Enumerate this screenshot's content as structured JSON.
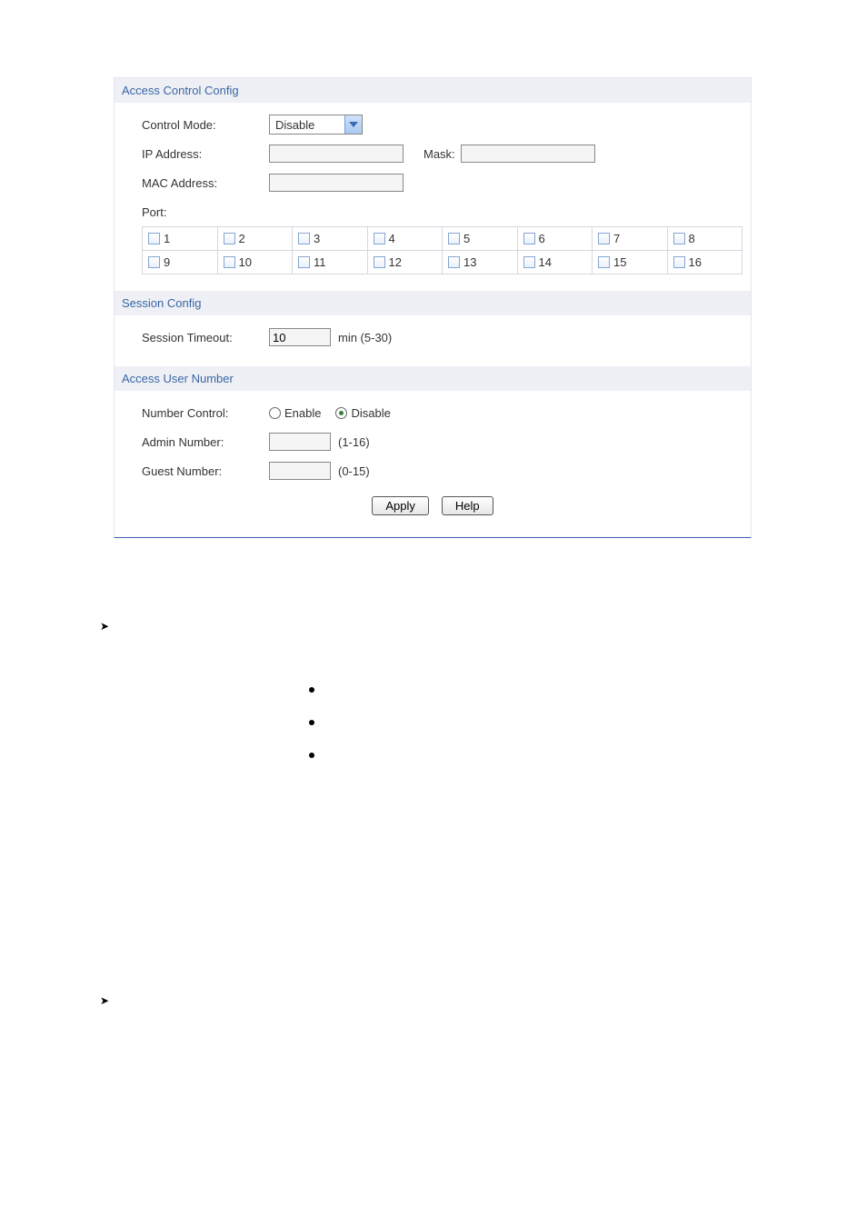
{
  "access_control": {
    "header": "Access Control Config",
    "control_mode_label": "Control Mode:",
    "control_mode_value": "Disable",
    "ip_address_label": "IP Address:",
    "ip_address_value": "",
    "mask_label": "Mask:",
    "mask_value": "",
    "mac_address_label": "MAC Address:",
    "mac_address_value": "",
    "port_label": "Port:",
    "ports_row1": [
      "1",
      "2",
      "3",
      "4",
      "5",
      "6",
      "7",
      "8"
    ],
    "ports_row2": [
      "9",
      "10",
      "11",
      "12",
      "13",
      "14",
      "15",
      "16"
    ]
  },
  "session": {
    "header": "Session Config",
    "timeout_label": "Session Timeout:",
    "timeout_value": "10",
    "timeout_hint": "min (5-30)"
  },
  "access_user": {
    "header": "Access User Number",
    "number_control_label": "Number Control:",
    "enable_label": "Enable",
    "disable_label": "Disable",
    "number_control_selected": "disable",
    "admin_label": "Admin Number:",
    "admin_value": "",
    "admin_hint": "(1-16)",
    "guest_label": "Guest Number:",
    "guest_value": "",
    "guest_hint": "(0-15)"
  },
  "buttons": {
    "apply": "Apply",
    "help": "Help"
  }
}
